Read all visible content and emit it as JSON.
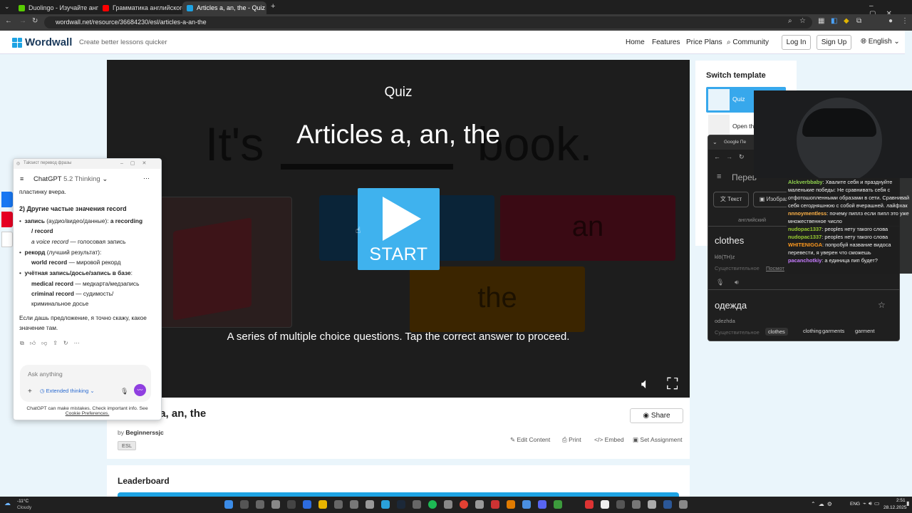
{
  "browser": {
    "tabs": [
      {
        "label": "Duolingo - Изучайте английск",
        "color": "#58cc02"
      },
      {
        "label": "Грамматика английского язы",
        "color": "#ff0000"
      },
      {
        "label": "Articles a, an, the - Quiz",
        "color": "#1ea3e3"
      }
    ],
    "url": "wordwall.net/resource/36684230/esl/articles-a-an-the",
    "new_tab": "+"
  },
  "site": {
    "logo": "Wordwall",
    "tagline": "Create better lessons quicker",
    "nav": {
      "home": "Home",
      "features": "Features",
      "plans": "Price Plans",
      "community": "Community"
    },
    "login": "Log In",
    "signup": "Sign Up",
    "language": "English"
  },
  "game": {
    "mode": "Quiz",
    "title": "Articles a, an, the",
    "ghost_sentence_start": "It's",
    "ghost_sentence_end": "book.",
    "ghost_options": [
      "an",
      "the"
    ],
    "start_label": "START",
    "description": "A series of multiple choice questions. Tap the correct answer to proceed."
  },
  "resource": {
    "title": "Articles a, an, the",
    "by": "by",
    "author": "Beginnerssjc",
    "tag": "ESL",
    "share": "Share",
    "actions": {
      "edit": "Edit Content",
      "print": "Print",
      "embed": "Embed",
      "assign": "Set Assignment"
    }
  },
  "leaderboard": {
    "title": "Leaderboard"
  },
  "switch_template": {
    "title": "Switch template",
    "items": [
      {
        "label": "Quiz"
      },
      {
        "label": "Open th"
      }
    ]
  },
  "chatgpt": {
    "window_title": "Тaksист перевод фразы",
    "model": "ChatGPT",
    "version": "5.2 Thinking",
    "text": {
      "intro": "пластинку вчера.",
      "heading": "2) Другие частые значения record",
      "b1_a": "запись",
      "b1_b": " (аудио/видео/данные): ",
      "b1_c": "a recording",
      "b1_d": "/ record",
      "b1_e": "a voice record",
      "b1_f": " — голосовая запись",
      "b2_a": "рекорд",
      "b2_b": " (лучший результат):",
      "b2_c": "world record",
      "b2_d": " — мировой рекорд",
      "b3_a": "учётная запись/досье/запись в базе",
      "b3_b": ":",
      "b3_c": "medical record",
      "b3_d": " — медкарта/медзапись",
      "b3_e": "criminal record",
      "b3_f": " — судимость/",
      "b3_g": "криминальное досье",
      "outro1": "Если дашь предложение, я точно скажу, какое",
      "outro2": "значение там."
    },
    "placeholder": "Ask anything",
    "thinking": "Extended thinking",
    "disclaimer1": "ChatGPT can make mistakes. Check important info. See",
    "disclaimer2": "Cookie Preferences."
  },
  "translator": {
    "header": "Google Пе",
    "app_title": "Перев",
    "text_tab": "Текст",
    "image_tab": "Изображ",
    "lang": "английский",
    "source": "clothes",
    "phonetic": "klō(TH)z",
    "pos": "Существительное",
    "more": "Посмот",
    "result": "одежда",
    "translit": "odezhda",
    "pos2": "Существительное",
    "chips": [
      "clothes",
      "clothing",
      "garments",
      "garment"
    ]
  },
  "twitch": {
    "messages": [
      {
        "user": "Alckverbbaby",
        "color": "#8fd14f",
        "text": ": Хвалите себя и празднуйте маленькие победы: Не сравнивать себя с отфотошопленными образами в сети. Сравнивай себя сегодняшнюю с собой вчерашней. лайфхак"
      },
      {
        "user": "nnnoymentless",
        "color": "#ffb347",
        "text": ": почему пиплз если пипл это уже множественное число"
      },
      {
        "user": "nudopac1337",
        "color": "#9acd32",
        "text": ": peoples нету такого слова"
      },
      {
        "user": "nudopac1337",
        "color": "#9acd32",
        "text": ": peoples нету такого слова"
      },
      {
        "user": "WHITENIGGA",
        "color": "#ff9a1f",
        "text": ": попробуй название видоса перевести, я уверен что сможешь"
      },
      {
        "user": "pacanchotkiy",
        "color": "#c77dff",
        "text": ": а единица пип будет?"
      }
    ]
  },
  "taskbar": {
    "weather_temp": "-11°C",
    "weather_text": "Cloudy",
    "lang": "ENG",
    "time": "2:51",
    "date": "28.12.2025"
  }
}
